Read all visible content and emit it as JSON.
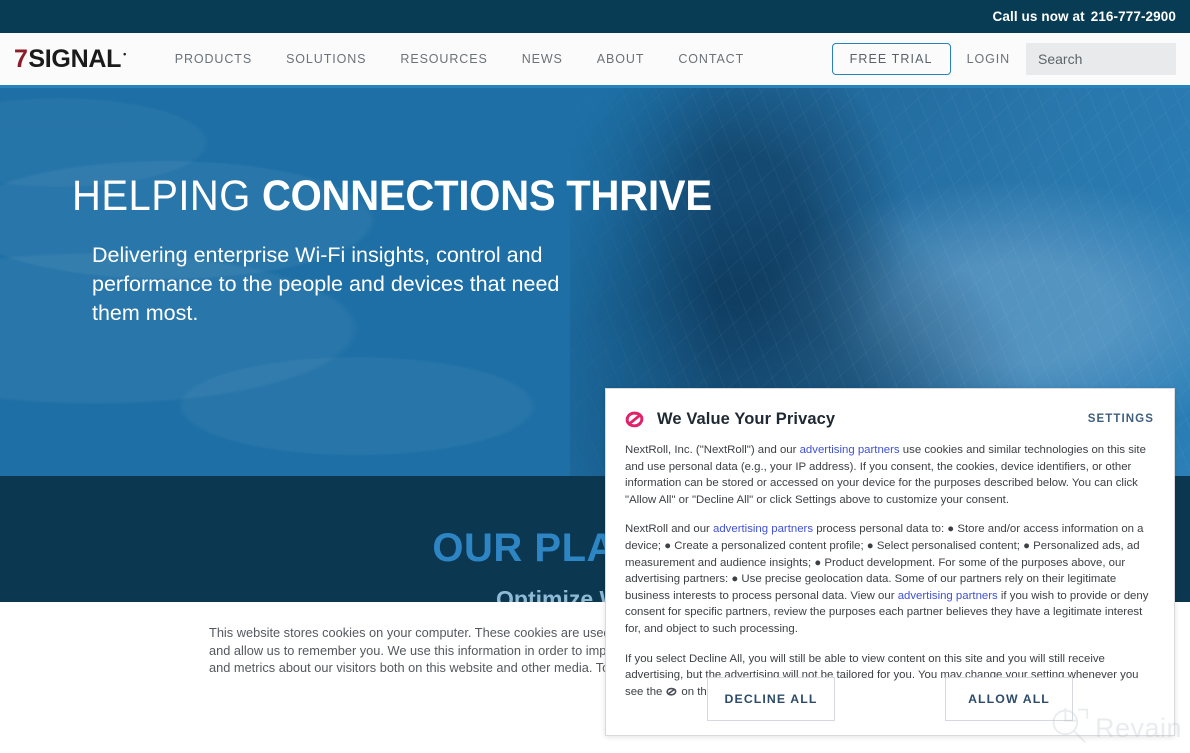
{
  "topbar": {
    "call_label": "Call us now at",
    "phone": "216-777-2900"
  },
  "brand": {
    "seven": "7",
    "word": "SIGNAL",
    "registered": "•"
  },
  "nav": {
    "items": [
      {
        "label": "PRODUCTS"
      },
      {
        "label": "SOLUTIONS"
      },
      {
        "label": "RESOURCES"
      },
      {
        "label": "NEWS"
      },
      {
        "label": "ABOUT"
      },
      {
        "label": "CONTACT"
      }
    ],
    "free_trial": "FREE TRIAL",
    "login": "LOGIN",
    "search_placeholder": "Search",
    "search_value": ""
  },
  "hero": {
    "heading_light": "HELPING",
    "heading_bold": "CONNECTIONS THRIVE",
    "subheading": "Delivering enterprise Wi-Fi insights, control and performance to the people and devices that need them most."
  },
  "platform": {
    "title": "OUR PLATFORM",
    "subtitle": "Optimize Wireless"
  },
  "cookie_banner": {
    "text": "This website stores cookies on your computer. These cookies are used to collect information about how you interact with our website and allow us to remember you. We use this information in order to improve and customize your browsing experience and for analytics and metrics about our visitors both on this website and other media. To find out more about the cookies we use on"
  },
  "consent": {
    "title": "We Value Your Privacy",
    "settings_label": "SETTINGS",
    "logo_name": "nextroll-logo",
    "paragraph1": {
      "before_link": "NextRoll, Inc. (\"NextRoll\") and our ",
      "link": "advertising partners",
      "after_link": " use cookies and similar technologies on this site and use personal data (e.g., your IP address). If you consent, the cookies, device identifiers, or other information can be stored or accessed on your device for the purposes described below. You can click \"Allow All\" or \"Decline All\" or click Settings above to customize your consent."
    },
    "paragraph2": {
      "before_link1": "NextRoll and our ",
      "link1": "advertising partners",
      "mid": " process personal data to: ● Store and/or access information on a device; ● Create a personalized content profile; ● Select personalised content; ● Personalized ads, ad measurement and audience insights; ● Product development. For some of the purposes above, our advertising partners: ● Use precise geolocation data. Some of our partners rely on their legitimate business interests to process personal data. View our ",
      "link2": "advertising partners",
      "tail": " if you wish to provide or deny consent for specific partners, review the purposes each partner believes they have a legitimate interest for, and object to such processing."
    },
    "paragraph3": {
      "before_icon": "If you select Decline All, you will still be able to view content on this site and you will still receive advertising, but the advertising will not be tailored for you. You may change your setting whenever you see the",
      "after_icon": "on this site."
    },
    "decline_label": "DECLINE ALL",
    "allow_label": "ALLOW ALL"
  },
  "watermark": {
    "text": "Revain"
  },
  "colors": {
    "topbar_bg": "#083c55",
    "nav_accent": "#2683bd",
    "hero_blue": "#1d6fa5",
    "dark_teal": "#0b3850",
    "brand_red": "#8c1d2a",
    "link_blue": "#3f51d6",
    "nextroll_pink": "#e1226a",
    "settings_blue": "#3f5f7d"
  }
}
